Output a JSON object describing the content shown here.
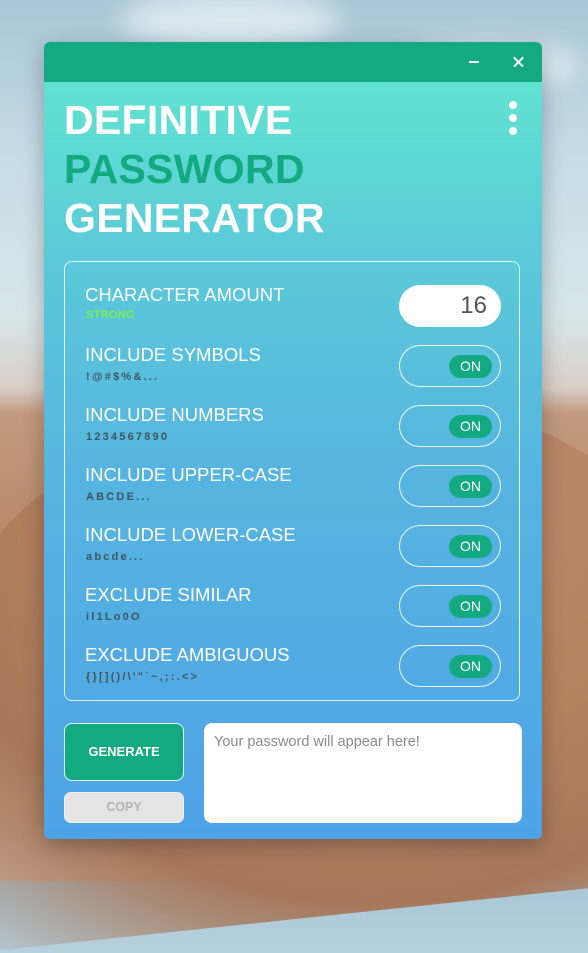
{
  "window": {
    "minimize_glyph": "–",
    "close_glyph": "×"
  },
  "title": {
    "line1": "DEFINITIVE",
    "line2": "PASSWORD",
    "line3": "GENERATOR"
  },
  "menu_icon": "kebab-menu-icon",
  "settings": {
    "character_amount": {
      "label": "CHARACTER AMOUNT",
      "strength": "STRONG",
      "value": "16"
    },
    "options": [
      {
        "label": "INCLUDE SYMBOLS",
        "example": "!@#$%&...",
        "state": "ON"
      },
      {
        "label": "INCLUDE NUMBERS",
        "example": "1234567890",
        "state": "ON"
      },
      {
        "label": "INCLUDE UPPER-CASE",
        "example": "ABCDE...",
        "state": "ON"
      },
      {
        "label": "INCLUDE LOWER-CASE",
        "example": "abcde...",
        "state": "ON"
      },
      {
        "label": "EXCLUDE SIMILAR",
        "example": "il1Lo0O",
        "state": "ON"
      },
      {
        "label": "EXCLUDE AMBIGUOUS",
        "example": "{}[]()/\\'\"`~,;:.<>",
        "state": "ON"
      }
    ]
  },
  "actions": {
    "generate_label": "GENERATE",
    "copy_label": "COPY"
  },
  "output": {
    "value": "",
    "placeholder": "Your password will appear here!"
  },
  "colors": {
    "accent": "#13a981",
    "strength": "#7cf050",
    "gradient_top": "#62e8cf",
    "gradient_bottom": "#4ea3e6"
  }
}
